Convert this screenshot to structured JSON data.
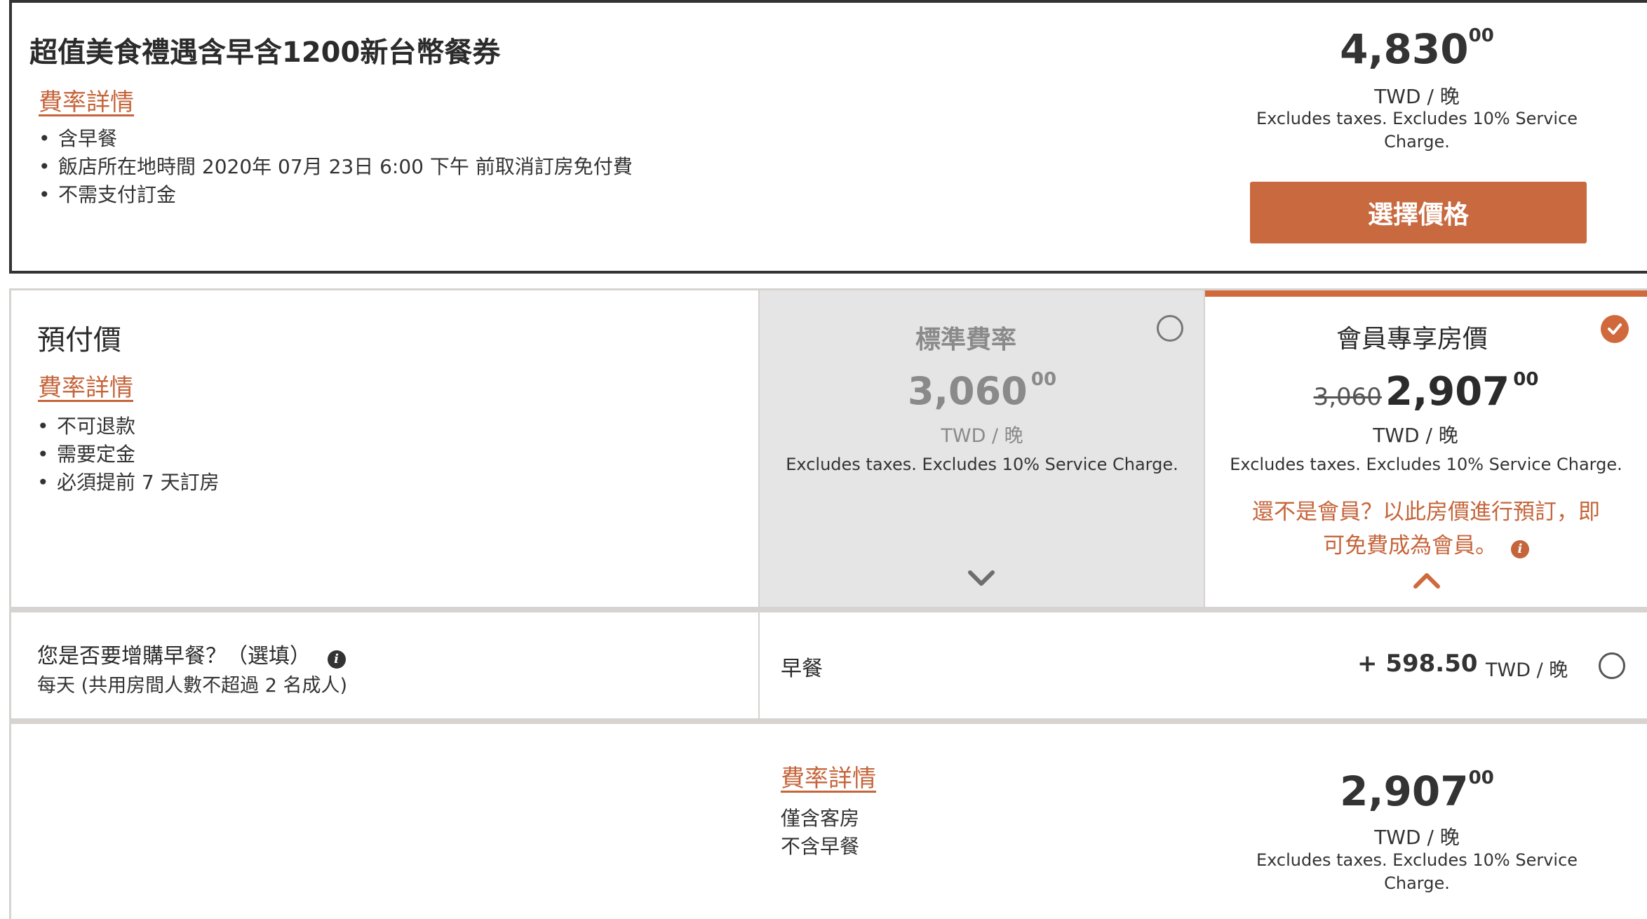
{
  "package_card": {
    "title": "超值美食禮遇含早含1200新台幣餐券",
    "rate_details_link": "費率詳情",
    "bullets": [
      "含早餐",
      "飯店所在地時間 2020年 07月 23日 6:00 下午 前取消訂房免付費",
      "不需支付訂金"
    ],
    "price_main": "4,830",
    "price_cents": "00",
    "unit": "TWD / 晚",
    "excludes": "Excludes taxes. Excludes 10% Service Charge.",
    "select_button": "選擇價格"
  },
  "prepaid": {
    "title": "預付價",
    "rate_details_link": "費率詳情",
    "bullets": [
      "不可退款",
      "需要定金",
      "必須提前 7 天訂房"
    ]
  },
  "standard_rate": {
    "title": "標準費率",
    "price_main": "3,060",
    "price_cents": "00",
    "unit": "TWD / 晚",
    "excludes": "Excludes taxes. Excludes 10% Service Charge."
  },
  "member_rate": {
    "title": "會員專享房價",
    "old_price": "3,060",
    "price_main": "2,907",
    "price_cents": "00",
    "unit": "TWD / 晚",
    "excludes": "Excludes taxes. Excludes 10% Service Charge.",
    "promo_line1": "還不是會員？以此房價進行預訂，即",
    "promo_line2": "可免費成為會員。"
  },
  "breakfast_addon": {
    "question": "您是否要增購早餐？（選填）",
    "subtext": "每天 (共用房間人數不超過 2 名成人)",
    "label": "早餐",
    "price": "+ 598.50",
    "unit": "TWD / 晚"
  },
  "room_only": {
    "rate_details_link": "費率詳情",
    "line1": "僅含客房",
    "line2": "不含早餐",
    "price_main": "2,907",
    "price_cents": "00",
    "unit": "TWD / 晚",
    "excludes": "Excludes taxes. Excludes 10% Service Charge."
  },
  "colors": {
    "accent": "#c8693f",
    "border_dark": "#333333",
    "divider": "#d6d3d0",
    "panel_grey": "#e5e5e5"
  }
}
